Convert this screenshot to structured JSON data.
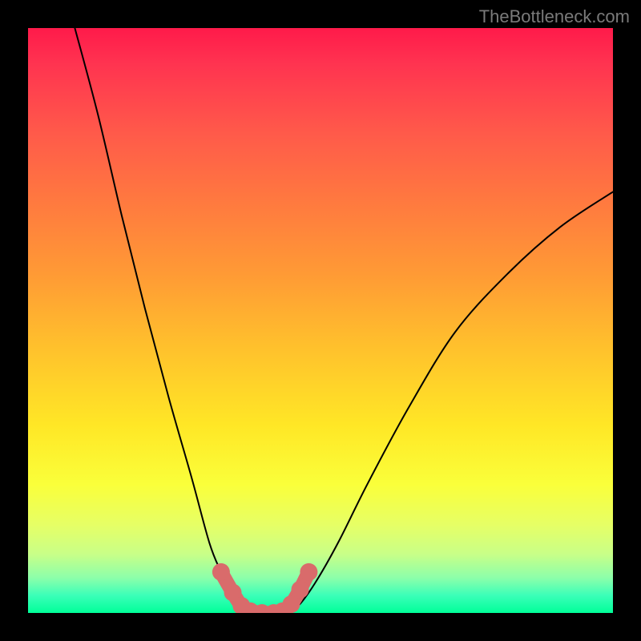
{
  "watermark": "TheBottleneck.com",
  "chart_data": {
    "type": "line",
    "title": "",
    "xlabel": "",
    "ylabel": "",
    "xlim": [
      0,
      100
    ],
    "ylim": [
      0,
      100
    ],
    "series": [
      {
        "name": "left-curve",
        "x": [
          8,
          12,
          16,
          20,
          24,
          28,
          31,
          33,
          35,
          37,
          39
        ],
        "y": [
          100,
          85,
          68,
          52,
          37,
          23,
          12,
          7,
          3,
          1,
          0
        ]
      },
      {
        "name": "right-curve",
        "x": [
          44,
          46,
          49,
          53,
          58,
          65,
          73,
          82,
          91,
          100
        ],
        "y": [
          0,
          1,
          5,
          12,
          22,
          35,
          48,
          58,
          66,
          72
        ]
      },
      {
        "name": "valley-floor",
        "x": [
          39,
          40,
          41,
          42,
          43,
          44
        ],
        "y": [
          0,
          0,
          0,
          0,
          0,
          0
        ]
      }
    ],
    "highlight": {
      "name": "valley-marker",
      "color": "#d96b6b",
      "points": [
        {
          "x": 33,
          "y": 7
        },
        {
          "x": 35,
          "y": 3.5
        },
        {
          "x": 36.5,
          "y": 1.2
        },
        {
          "x": 38,
          "y": 0.3
        },
        {
          "x": 40,
          "y": 0
        },
        {
          "x": 42,
          "y": 0
        },
        {
          "x": 43.5,
          "y": 0.3
        },
        {
          "x": 45,
          "y": 1.5
        },
        {
          "x": 46.5,
          "y": 4
        },
        {
          "x": 48,
          "y": 7
        }
      ]
    },
    "gradient_stops": [
      {
        "pos": 0,
        "color": "#ff1a4a"
      },
      {
        "pos": 50,
        "color": "#ffc22c"
      },
      {
        "pos": 100,
        "color": "#00ff99"
      }
    ]
  }
}
